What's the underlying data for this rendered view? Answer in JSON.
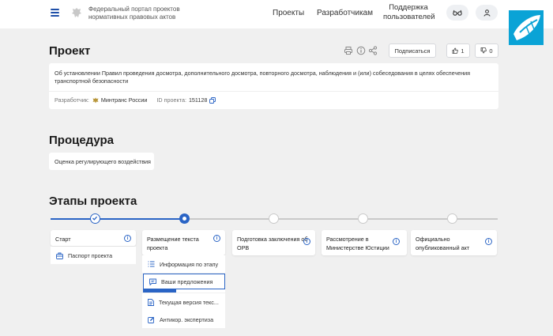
{
  "header": {
    "portal_title": "Федеральный портал проектов нормативных правовых актов",
    "nav": {
      "projects": "Проекты",
      "developers": "Разработчикам",
      "support": "Поддержка пользователей"
    },
    "icons": [
      "menu-icon",
      "emblem-icon",
      "glasses-icon",
      "user-icon"
    ]
  },
  "project": {
    "title": "Проект",
    "subscribe_label": "Подписаться",
    "likes": "1",
    "dislikes": "0",
    "description": "Об установлении Правил проведения досмотра, дополнительного досмотра, повторного досмотра, наблюдения и (или) собеседования в целях обеспечения транспортной безопасности",
    "developer_label": "Разработчик:",
    "developer": "Минтранс России",
    "id_label": "ID проекта:",
    "id": "151128"
  },
  "procedure": {
    "title": "Процедура",
    "value": "Оценка регулирующего воздействия"
  },
  "stages": {
    "title": "Этапы проекта",
    "items": [
      {
        "label": "Старт",
        "state": "done"
      },
      {
        "label": "Размещение текста проекта",
        "state": "current"
      },
      {
        "label": "Подготовка заключения об ОРВ",
        "state": "pending"
      },
      {
        "label": "Рассмотрение в Министерстве Юстиции",
        "state": "pending"
      },
      {
        "label": "Официально опубликованный акт",
        "state": "pending"
      }
    ],
    "start_items": [
      {
        "label": "Паспорт проекта",
        "icon": "passport-icon"
      }
    ],
    "current_items": [
      {
        "label": "Информация по этапу",
        "icon": "list-icon"
      },
      {
        "label": "Ваши предложения",
        "icon": "comment-icon",
        "active": true
      },
      {
        "label": "Текущая версия текс...",
        "icon": "document-icon"
      },
      {
        "label": "Антикор. экспертиза",
        "icon": "edit-icon"
      }
    ],
    "suggestions_progress": 0.4
  },
  "colors": {
    "accent": "#2a64c5",
    "background": "#f0f0f0",
    "card": "#ffffff"
  }
}
